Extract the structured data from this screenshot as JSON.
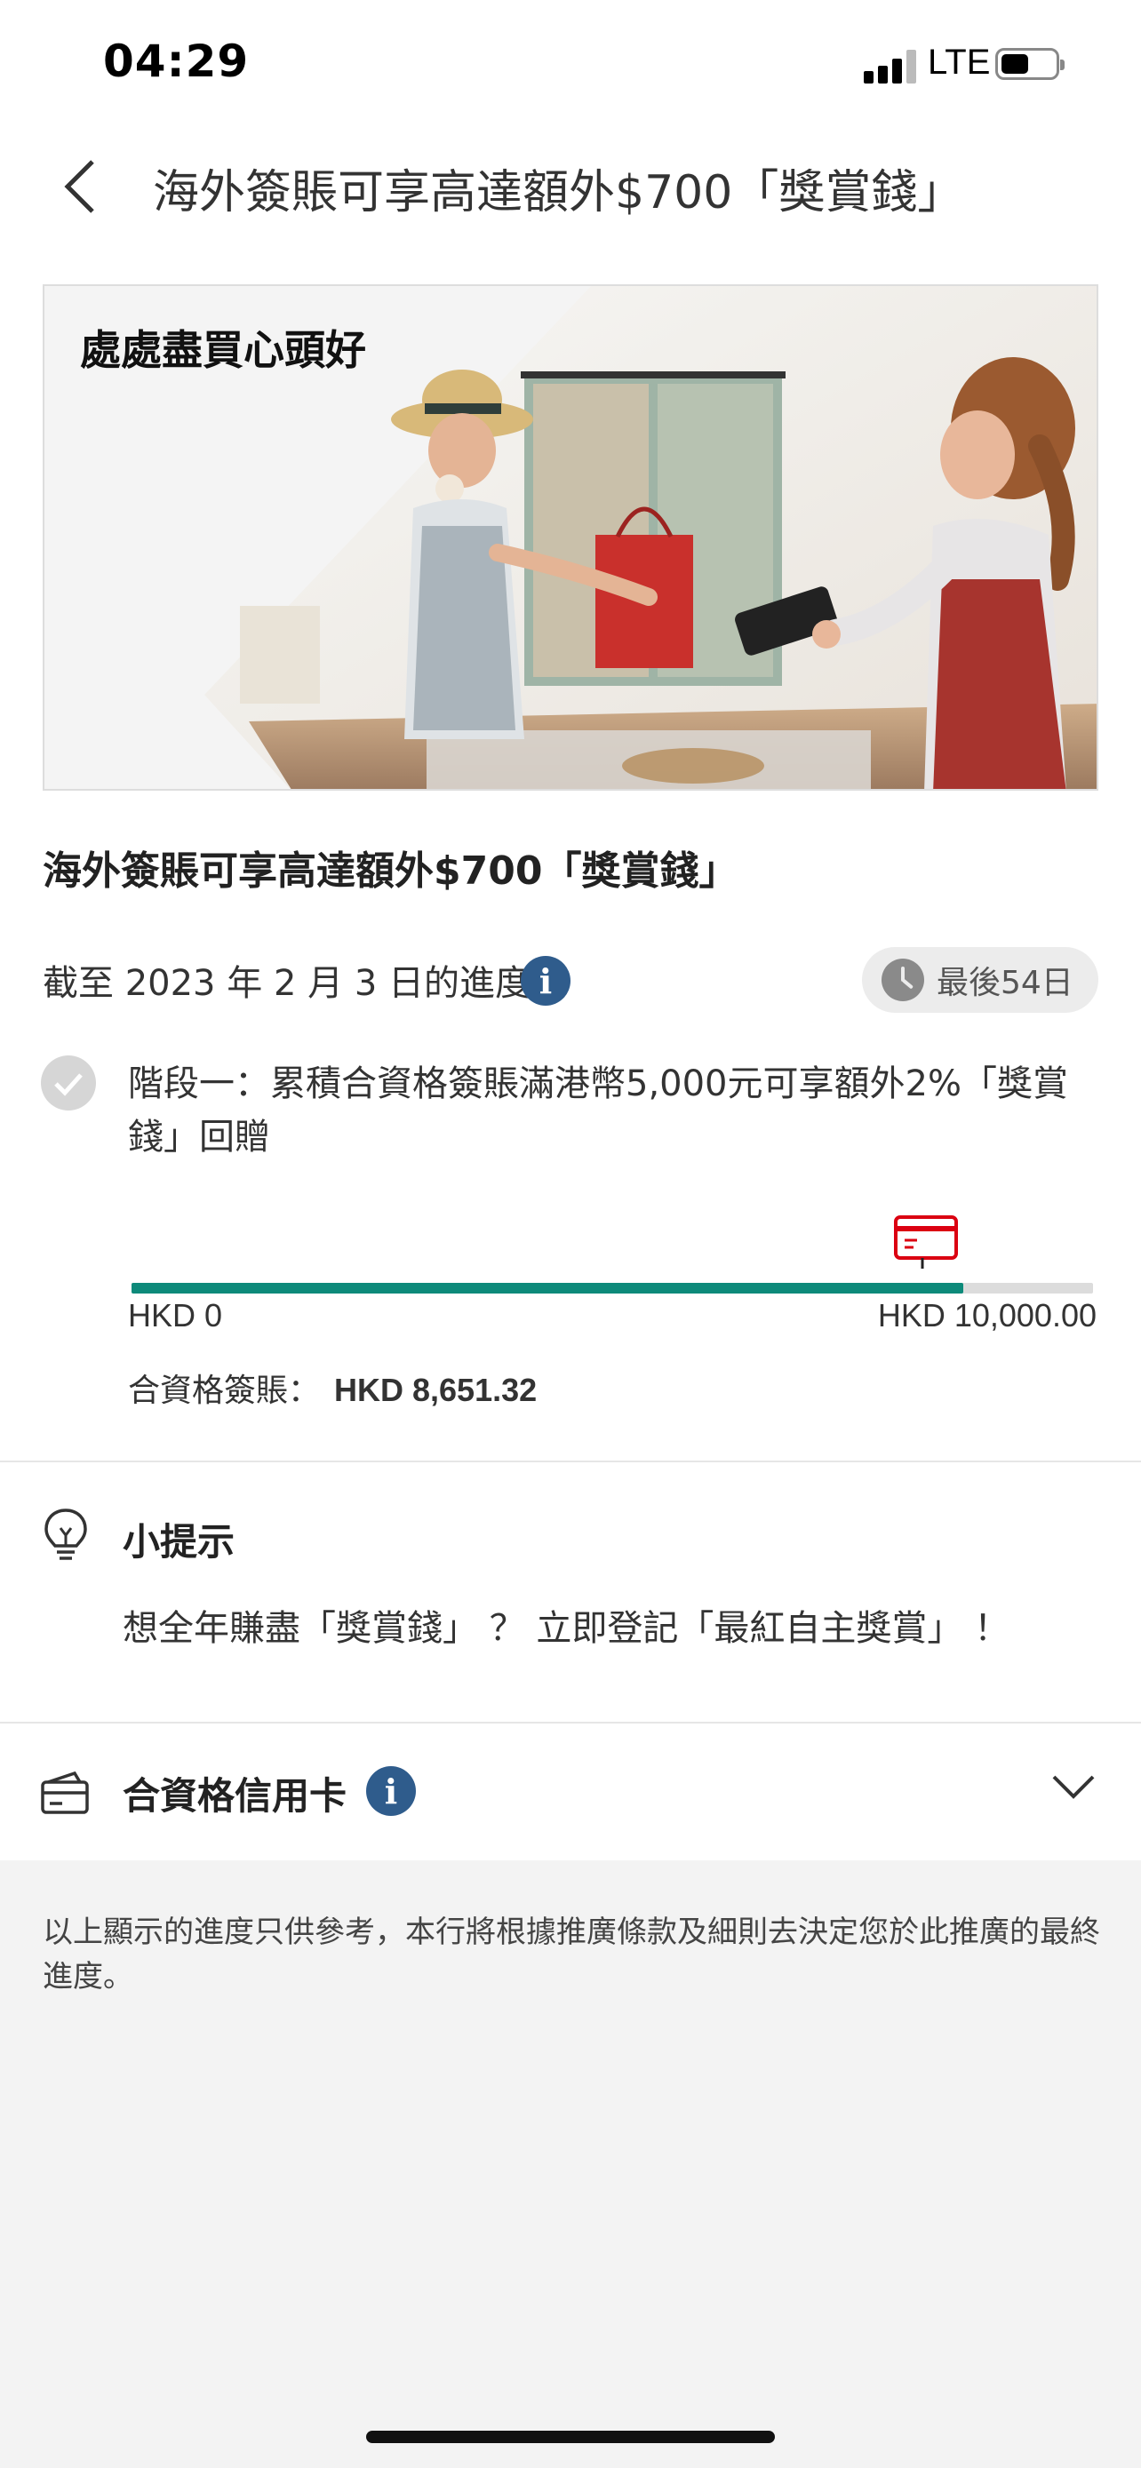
{
  "status_bar": {
    "time": "04:29",
    "network": "LTE"
  },
  "header": {
    "title": "海外簽賬可享高達額外$700「獎賞錢」"
  },
  "banner": {
    "slogan": "處處盡買心頭好"
  },
  "promo": {
    "title": "海外簽賬可享高達額外$700「獎賞錢」"
  },
  "progress": {
    "date_text": "截至 2023 年 2 月 3 日的進度",
    "info_icon": "i",
    "days_left": "最後54日"
  },
  "stage": {
    "text": "階段一：累積合資格簽賬滿港幣5,000元可享額外2%「獎賞錢」回贈",
    "completed": true
  },
  "bar": {
    "min_label": "HKD 0",
    "max_label": "HKD 10,000.00",
    "progress_fraction": 0.865
  },
  "eligible_spending": {
    "label": "合資格簽賬：",
    "amount": "HKD 8,651.32"
  },
  "tip": {
    "title": "小提示",
    "text": "想全年賺盡「獎賞錢」 ？ 立即登記「最紅自主獎賞」 ！"
  },
  "cards": {
    "label": "合資格信用卡",
    "info_icon": "i"
  },
  "disclaimer": "以上顯示的進度只供參考，本行將根據推廣條款及細則去決定您於此推廣的最終進度。",
  "colors": {
    "accent": "#0d8a7a",
    "info": "#2f5c8c",
    "marker": "#db0011"
  },
  "icons": [
    "signal-icon",
    "battery-icon",
    "back-chevron-icon",
    "info-icon",
    "clock-icon",
    "check-icon",
    "credit-card-icon",
    "lightbulb-icon",
    "wallet-icon",
    "chevron-down-icon"
  ]
}
